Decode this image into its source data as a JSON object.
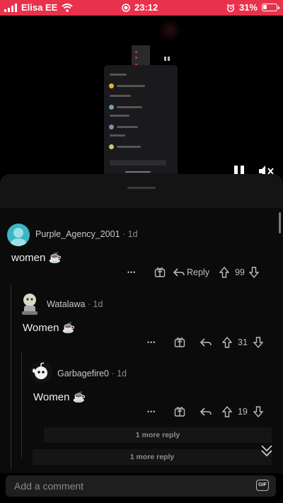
{
  "statusbar": {
    "carrier": "Elisa EE",
    "time": "23:12",
    "battery": "31%",
    "battery_level": 0.31
  },
  "comments": [
    {
      "username": "Purple_Agency_2001",
      "age": "· 1d",
      "text": "women ☕",
      "more": "•••",
      "reply_label": "Reply",
      "votes": "99",
      "avatar_color": "#3bb7c4"
    },
    {
      "username": "Watalawa",
      "age": "· 1d",
      "text": "Women ☕",
      "more": "•••",
      "votes": "31"
    },
    {
      "username": "Garbagefire0",
      "age": "· 1d",
      "text": "Women ☕",
      "more": "•••",
      "votes": "19"
    }
  ],
  "more_replies": [
    {
      "label": "1 more reply"
    },
    {
      "label": "1 more reply"
    }
  ],
  "composer": {
    "placeholder": "Add a comment",
    "gif_label": "GIF"
  },
  "icons": {
    "signal": "signal-icon",
    "wifi": "wifi-icon",
    "recording": "recording-icon",
    "alarm": "alarm-icon",
    "pause": "pause-icon",
    "mute": "mute-icon",
    "award": "award-icon",
    "reply": "reply-icon",
    "upvote": "upvote-icon",
    "downvote": "downvote-icon",
    "collapse": "chevron-double-down-icon"
  }
}
